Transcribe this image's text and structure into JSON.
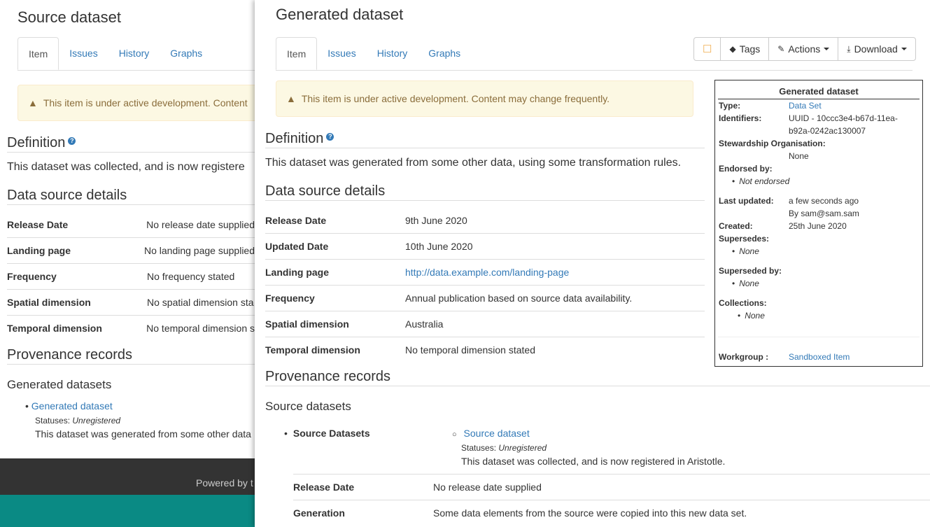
{
  "source": {
    "title": "Source dataset",
    "tabs": [
      "Item",
      "Issues",
      "History",
      "Graphs"
    ],
    "alert": "This item is under active development. Content",
    "definition_heading": "Definition",
    "definition_text": "This dataset was collected, and is now registere",
    "details_heading": "Data source details",
    "details": [
      {
        "label": "Release Date",
        "value": "No release date supplied"
      },
      {
        "label": "Landing page",
        "value": "No landing page supplied"
      },
      {
        "label": "Frequency",
        "value": "No frequency stated"
      },
      {
        "label": "Spatial dimension",
        "value": "No spatial dimension sta"
      },
      {
        "label": "Temporal dimension",
        "value": "No temporal dimension s"
      }
    ],
    "provenance_heading": "Provenance records",
    "generated_heading": "Generated datasets",
    "generated_link": "Generated dataset",
    "generated_status_label": "Statuses:",
    "generated_status": "Unregistered",
    "generated_desc": "This dataset was generated from some other data",
    "footer_text": "Powered by t"
  },
  "generated": {
    "title": "Generated dataset",
    "tabs": [
      "Item",
      "Issues",
      "History",
      "Graphs"
    ],
    "toolbar": {
      "tags": "Tags",
      "actions": "Actions",
      "download": "Download"
    },
    "alert": "This item is under active development. Content may change frequently.",
    "definition_heading": "Definition",
    "definition_text": "This dataset was generated from some other data, using some transformation rules.",
    "details_heading": "Data source details",
    "details": [
      {
        "label": "Release Date",
        "value": "9th June 2020"
      },
      {
        "label": "Updated Date",
        "value": "10th June 2020"
      },
      {
        "label": "Landing page",
        "value": "http://data.example.com/landing-page"
      },
      {
        "label": "Frequency",
        "value": "Annual publication based on source data availability."
      },
      {
        "label": "Spatial dimension",
        "value": "Australia"
      },
      {
        "label": "Temporal dimension",
        "value": "No temporal dimension stated"
      }
    ],
    "provenance_heading": "Provenance records",
    "source_heading": "Source datasets",
    "source_bullet": "Source Datasets",
    "source_link": "Source dataset",
    "source_status_label": "Statuses:",
    "source_status": "Unregistered",
    "source_desc": "This dataset was collected, and is now registered in Aristotle.",
    "source_details": [
      {
        "label": "Release Date",
        "value": "No release date supplied"
      },
      {
        "label": "Generation",
        "value": "Some data elements from the source were copied into this new data set."
      }
    ],
    "infobox": {
      "title": "Generated dataset",
      "type_label": "Type:",
      "type_value": "Data Set",
      "identifiers_label": "Identifiers:",
      "identifiers_line1": "UUID - 10ccc3e4-b67d-11ea-",
      "identifiers_line2": "b92a-0242ac130007",
      "stewardship_label": "Stewardship Organisation:",
      "stewardship_value": "None",
      "endorsed_label": "Endorsed by:",
      "endorsed_value": "Not endorsed",
      "last_updated_label": "Last updated:",
      "last_updated_value": "a few seconds ago",
      "last_updated_by": "By sam@sam.sam",
      "created_label": "Created:",
      "created_value": "25th June 2020",
      "supersedes_label": "Supersedes:",
      "supersedes_value": "None",
      "superseded_label": "Superseded by:",
      "superseded_value": "None",
      "collections_label": "Collections:",
      "collections_value": "None",
      "workgroup_label": "Workgroup :",
      "workgroup_value": "Sandboxed Item"
    }
  },
  "colors": {
    "link": "#337ab7",
    "alert_bg": "#fcf8e3",
    "alert_text": "#8a6d3b",
    "footer": "#333333",
    "teal_band": "#0a8a84"
  }
}
